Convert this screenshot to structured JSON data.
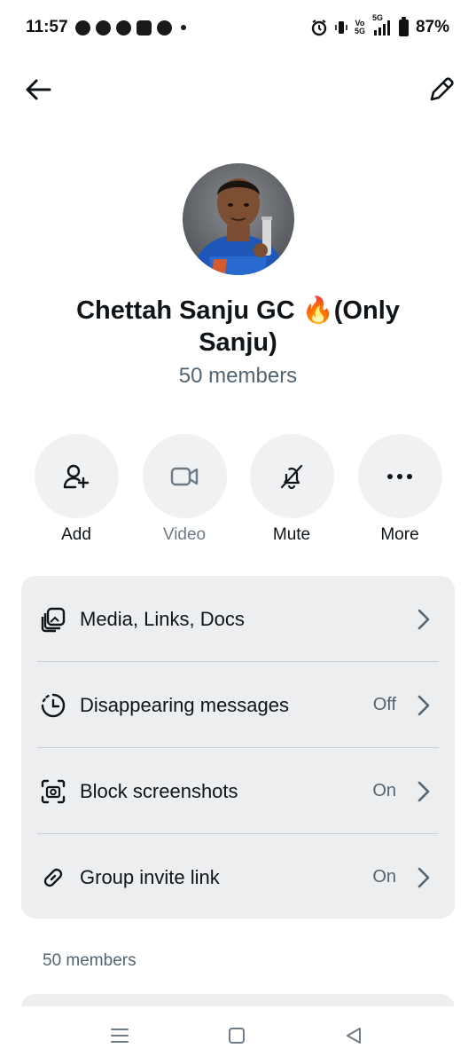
{
  "status_bar": {
    "time": "11:57",
    "network": "5G",
    "volte": "Vo\n5G",
    "battery": "87%"
  },
  "header": {
    "back_icon": "back-arrow-icon",
    "edit_icon": "pencil-icon"
  },
  "group": {
    "title": "Chettah Sanju GC 🔥(Only Sanju)",
    "members_count": "50 members"
  },
  "actions": [
    {
      "label": "Add",
      "icon": "add-person-icon",
      "enabled": true
    },
    {
      "label": "Video",
      "icon": "video-camera-icon",
      "enabled": false
    },
    {
      "label": "Mute",
      "icon": "bell-off-icon",
      "enabled": true
    },
    {
      "label": "More",
      "icon": "more-dots-icon",
      "enabled": true
    }
  ],
  "settings": [
    {
      "label": "Media, Links, Docs",
      "value": "",
      "icon": "media-gallery-icon"
    },
    {
      "label": "Disappearing messages",
      "value": "Off",
      "icon": "timer-icon"
    },
    {
      "label": "Block screenshots",
      "value": "On",
      "icon": "screenshot-block-icon"
    },
    {
      "label": "Group invite link",
      "value": "On",
      "icon": "link-icon"
    }
  ],
  "members_section": {
    "heading": "50 members"
  },
  "colors": {
    "primary_text": "#0f1419",
    "secondary_text": "#536471",
    "card_background": "#eceef0",
    "action_circle": "#eff1f3"
  }
}
